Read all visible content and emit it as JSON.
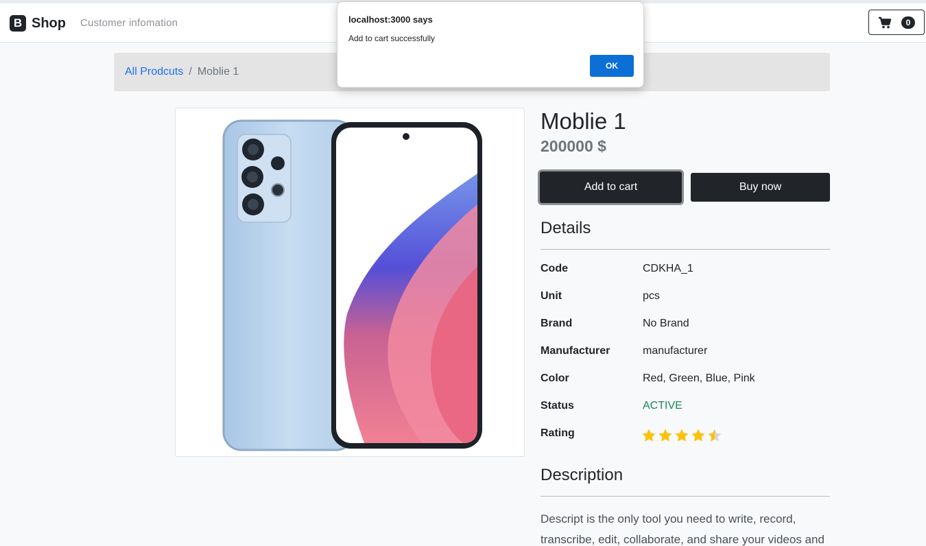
{
  "navbar": {
    "brand_logo": "B",
    "brand_text": "Shop",
    "customer_link": "Customer infomation",
    "cart_count": "0"
  },
  "breadcrumb": {
    "link": "All Prodcuts",
    "separator": "/",
    "current": "Moblie 1"
  },
  "product": {
    "title": "Moblie 1",
    "price": "200000 $",
    "add_to_cart": "Add to cart",
    "buy_now": "Buy now"
  },
  "details": {
    "heading": "Details",
    "rows": [
      {
        "label": "Code",
        "value": "CDKHA_1"
      },
      {
        "label": "Unit",
        "value": "pcs"
      },
      {
        "label": "Brand",
        "value": "No Brand"
      },
      {
        "label": "Manufacturer",
        "value": "manufacturer"
      },
      {
        "label": "Color",
        "value": "Red, Green, Blue, Pink"
      },
      {
        "label": "Status",
        "value": "ACTIVE"
      },
      {
        "label": "Rating",
        "value": ""
      }
    ],
    "rating_stars": 4.5,
    "rating_max": 5
  },
  "description": {
    "heading": "Description",
    "text": "Descript is the only tool you need to write, record, transcribe, edit, collaborate, and share your videos and"
  },
  "dialog": {
    "title": "localhost:3000 says",
    "message": "Add to cart successfully",
    "ok_label": "OK"
  },
  "colors": {
    "dark": "#212529",
    "link": "#1a6ff2",
    "status_active": "#198754",
    "star": "#ffc107",
    "dialog_button": "#0b6fd6"
  }
}
